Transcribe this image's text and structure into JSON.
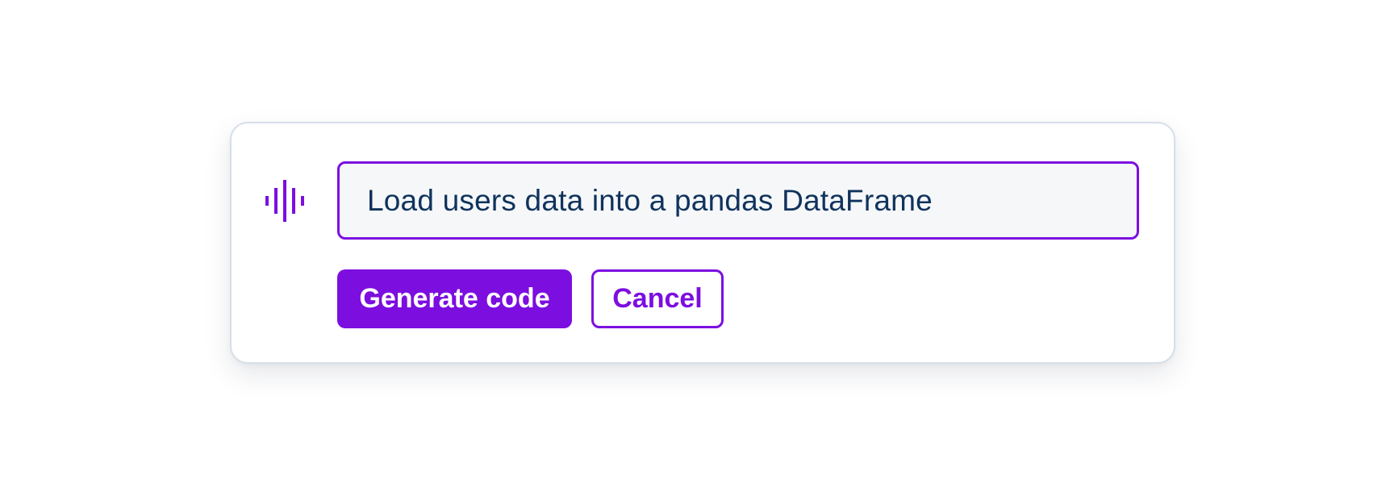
{
  "prompt": {
    "value": "Load users data into a pandas DataFrame",
    "icon": "audio-waveform-icon"
  },
  "actions": {
    "generate_label": "Generate code",
    "cancel_label": "Cancel"
  },
  "colors": {
    "accent": "#7c0ee0",
    "text": "#10335c",
    "input_bg": "#f5f7f9",
    "card_border": "#d6dfe8"
  }
}
